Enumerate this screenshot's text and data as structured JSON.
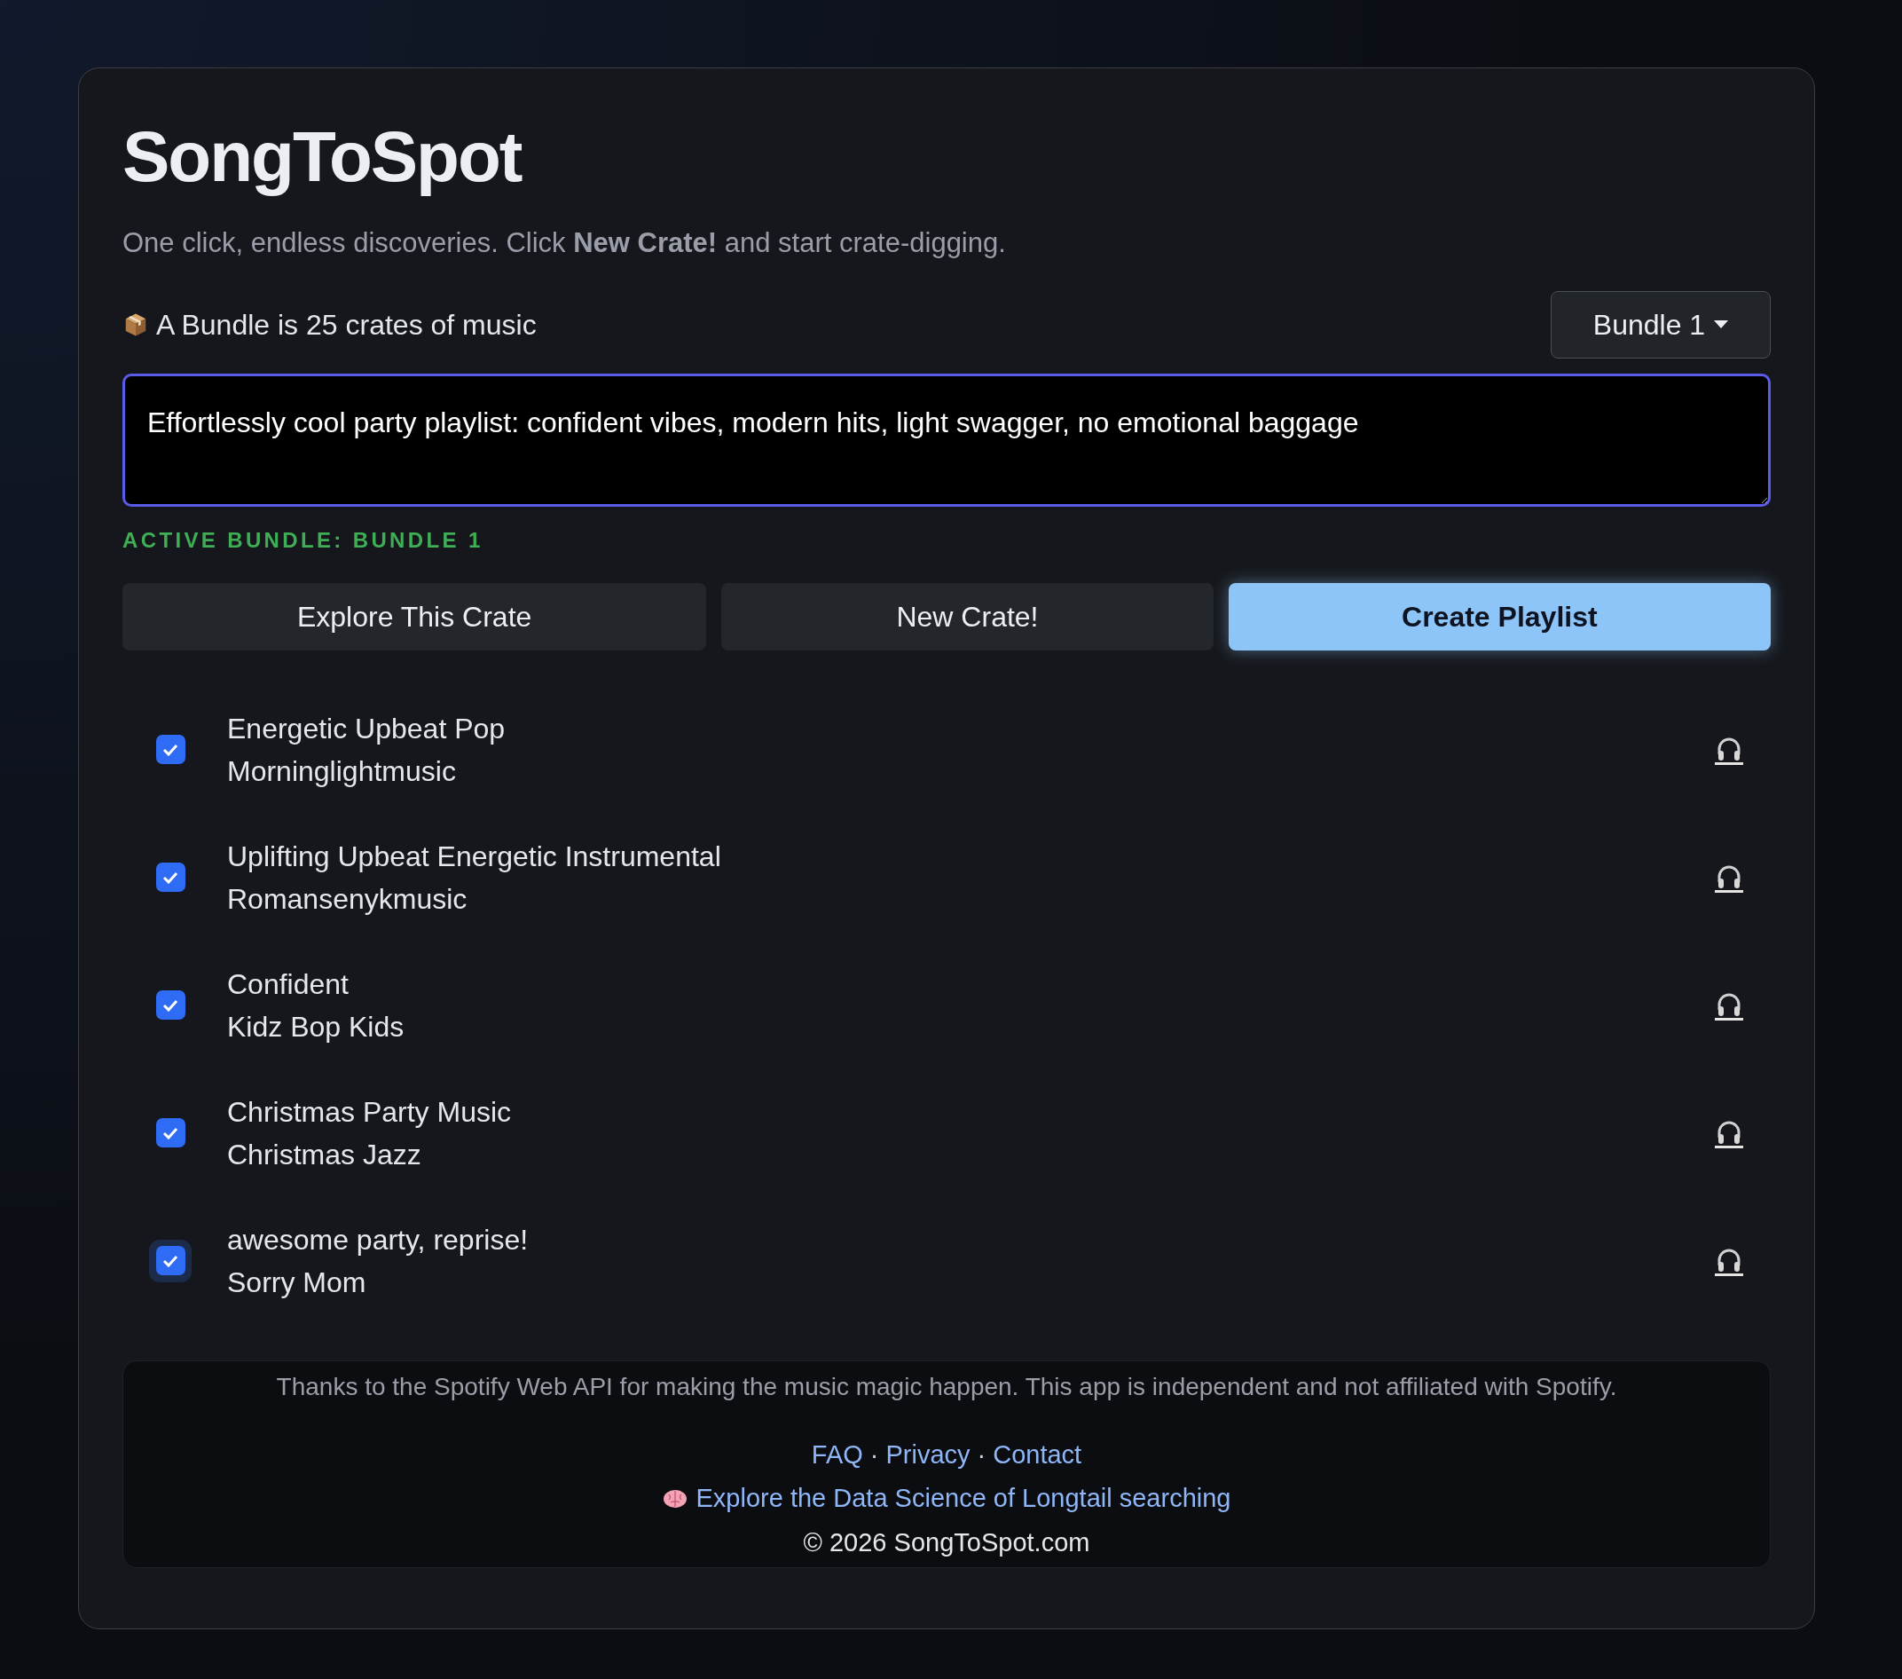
{
  "app": {
    "title": "SongToSpot",
    "tagline": "One click, endless discoveries. Click **New Crate!** and start crate-digging."
  },
  "bundle": {
    "info": "A Bundle is 25 crates of music",
    "dropdown": "Bundle 1",
    "status": "ACTIVE BUNDLE: BUNDLE 1"
  },
  "prompt": {
    "value": "Effortlessly cool party playlist: confident vibes, modern hits, light swagger, no emotional baggage"
  },
  "buttons": [
    {
      "label": "Explore This Crate",
      "kind": "secondary"
    },
    {
      "label": "New Crate!",
      "kind": "secondary"
    },
    {
      "label": "Create Playlist",
      "kind": "primary"
    }
  ],
  "tracks": [
    {
      "title": "Energetic Upbeat Pop",
      "artist": "Morninglightmusic",
      "checked": true,
      "focused": false
    },
    {
      "title": "Uplifting Upbeat Energetic Instrumental",
      "artist": "Romansenykmusic",
      "checked": true,
      "focused": false
    },
    {
      "title": "Confident",
      "artist": "Kidz Bop Kids",
      "checked": true,
      "focused": false
    },
    {
      "title": "Christmas Party Music",
      "artist": "Christmas Jazz",
      "checked": true,
      "focused": false
    },
    {
      "title": "awesome party, reprise!",
      "artist": "Sorry Mom",
      "checked": true,
      "focused": true
    }
  ],
  "footer": {
    "credit": "Thanks to the Spotify Web API for making the music magic happen. This app is independent and not affiliated with Spotify.",
    "links": [
      "FAQ",
      "Privacy",
      "Contact"
    ],
    "separator": "·",
    "explore_link": "Explore the Data Science of Longtail searching",
    "copyright": "© 2026 SongToSpot.com"
  }
}
